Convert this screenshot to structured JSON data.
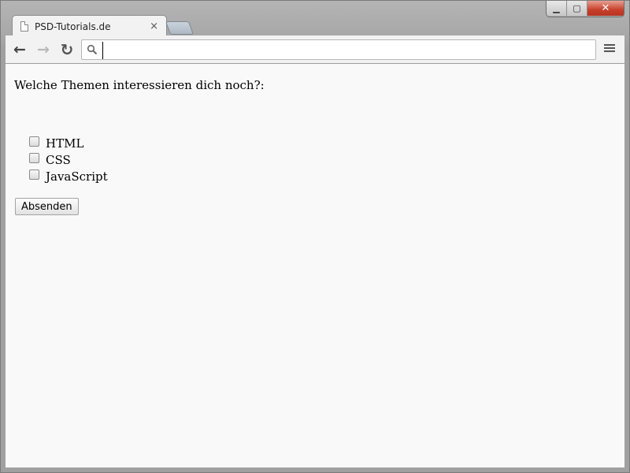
{
  "window": {
    "controls": {
      "minimize": "▁",
      "maximize": "▢",
      "close": "✕"
    }
  },
  "tab": {
    "title": "PSD-Tutorials.de",
    "close": "×"
  },
  "toolbar": {
    "back_icon": "←",
    "forward_icon": "→",
    "reload_icon": "↻",
    "omnibox_value": "",
    "menu_icon": "hamburger-menu"
  },
  "form": {
    "question": "Welche Themen interessieren dich noch?:",
    "options": [
      "HTML",
      "CSS",
      "JavaScript"
    ],
    "submit_label": "Absenden"
  }
}
